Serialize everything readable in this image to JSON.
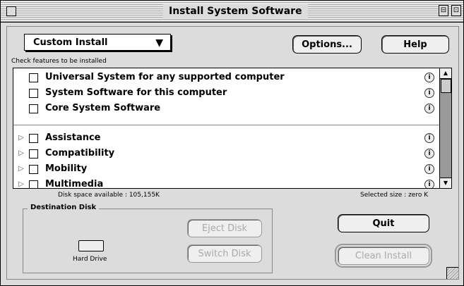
{
  "window": {
    "title": "Install System Software",
    "zoom_glyph": "⊟",
    "collapse_glyph": "⊡"
  },
  "install_type": {
    "selected": "Custom Install",
    "arrow": "▼"
  },
  "hint": "Check features to be installed",
  "buttons": {
    "options": "Options...",
    "help": "Help",
    "eject_disk": "Eject Disk",
    "switch_disk": "Switch Disk",
    "quit": "Quit",
    "clean_install": "Clean Install"
  },
  "features_top": [
    {
      "label": "Universal System for any supported computer",
      "checked": false
    },
    {
      "label": "System Software for this computer",
      "checked": false
    },
    {
      "label": "Core System Software",
      "checked": false
    }
  ],
  "features_bottom": [
    {
      "label": "Assistance",
      "checked": false
    },
    {
      "label": "Compatibility",
      "checked": false
    },
    {
      "label": "Mobility",
      "checked": false
    },
    {
      "label": "Multimedia",
      "checked": false
    }
  ],
  "info_glyph": "i",
  "disclosure_glyph": "▷",
  "status": {
    "disk_space": "Disk space available : 105,155K",
    "selected_size": "Selected size : zero K"
  },
  "destination": {
    "title": "Destination Disk",
    "disk_name": "Hard Drive"
  },
  "icons": {
    "scroll_up": "▲",
    "scroll_down": "▼"
  }
}
